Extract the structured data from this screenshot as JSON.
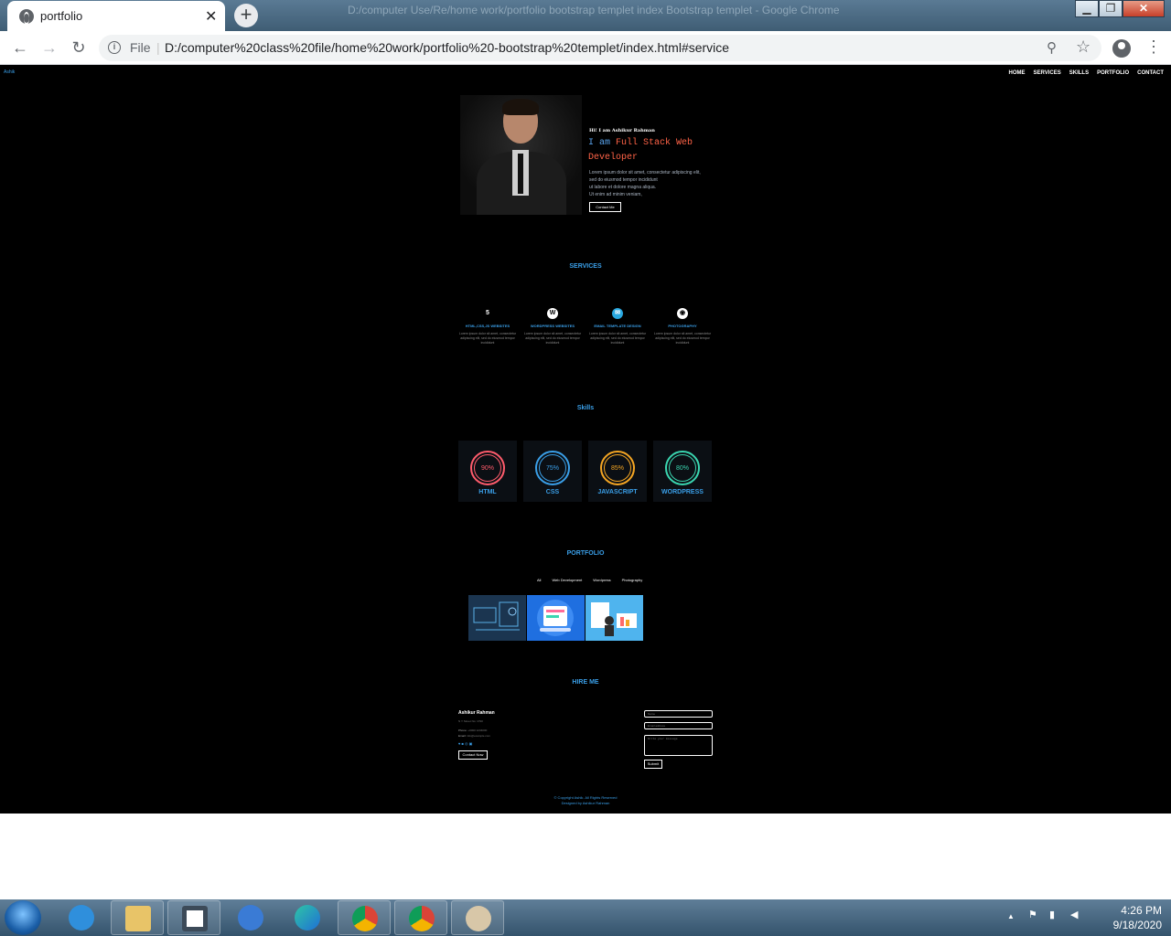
{
  "browser": {
    "tab_title": "portfolio",
    "tab_close": "✕",
    "new_tab": "+",
    "blurred_title": "D:/computer Use/Re/home work/portfolio bootstrap templet index Bootstrap templet - Google Chrome",
    "address": {
      "scheme_label": "File",
      "url": "D:/computer%20class%20file/home%20work/portfolio%20-bootstrap%20templet/index.html#service"
    },
    "icons": {
      "back": "back-arrow-icon",
      "forward": "forward-arrow-icon",
      "reload": "reload-icon",
      "zoom": "zoom-icon",
      "bookmark": "star-icon",
      "profile": "profile-icon",
      "menu": "kebab-menu-icon"
    }
  },
  "site": {
    "brand": "Ashik",
    "nav": [
      "HOME",
      "SERVICES",
      "SKILLS",
      "PORTFOLIO",
      "CONTACT"
    ],
    "hero": {
      "greeting": "Hi! I am Ashikur Rahman",
      "role_prefix": "I am",
      "role_line1": "Full Stack Web",
      "role_line2": "Developer",
      "intro": [
        "Lorem ipsum dolor sit amet, consectetur adipiscing elit,",
        "sed do eiusmod tempor incididunt",
        "ut labore et dolore magna aliqua.",
        "Ut enim ad minim veniam,"
      ],
      "cta": "Contact Me"
    },
    "services": {
      "title": "SERVICES",
      "items": [
        {
          "icon": "5",
          "title": "HTML,CSS,JS WEBSITES",
          "desc": "Lorem ipsum dolor sit amet, consectetur adipiscing elit, sed do eiusmod tempor incididunt"
        },
        {
          "icon": "W",
          "title": "WORDPRESS WEBSITES",
          "desc": "Lorem ipsum dolor sit amet, consectetur adipiscing elit, sed do eiusmod tempor incididunt"
        },
        {
          "icon": "✉",
          "title": "EMAIL TEMPLATE DESIGN",
          "desc": "Lorem ipsum dolor sit amet, consectetur adipiscing elit, sed do eiusmod tempor incididunt"
        },
        {
          "icon": "◉",
          "title": "PHOTOGRAPHY",
          "desc": "Lorem ipsum dolor sit amet, consectetur adipiscing elit, sed do eiusmod tempor incididunt"
        }
      ]
    },
    "skills": {
      "title": "Skills",
      "items": [
        {
          "name": "HTML",
          "percent": "90%",
          "color": "#ff5c6c"
        },
        {
          "name": "CSS",
          "percent": "75%",
          "color": "#3a9fe8"
        },
        {
          "name": "JAVASCRIPT",
          "percent": "85%",
          "color": "#f5a623"
        },
        {
          "name": "WORDPRESS",
          "percent": "80%",
          "color": "#3ad6b0"
        }
      ]
    },
    "portfolio": {
      "title": "PORTFOLIO",
      "filters": [
        "All",
        "Web Development",
        "Wordpress",
        "Photography"
      ]
    },
    "hire": {
      "title": "HIRE ME",
      "name": "Ashikur Rahman",
      "address": "N Y Street No: 1790",
      "phone_label": "Phone:",
      "phone": "+0000 1234000",
      "email_label": "Email:",
      "email": "info@example.com",
      "social": "♥ ■ ◎ ▣",
      "cta": "Contact Now",
      "form": {
        "name_placeholder": "Name",
        "email_placeholder": "Email address",
        "message_placeholder": "Write your message",
        "submit": "Submit"
      }
    },
    "footer": {
      "line1": "© Copyright Ashik. All Rights Reserved",
      "line2": "Designed by Ashikur Rahman"
    }
  },
  "taskbar": {
    "apps": [
      "internet-explorer-icon",
      "file-explorer-icon",
      "app-icon",
      "webcam-icon",
      "edge-icon",
      "chrome-icon",
      "chrome-icon",
      "paint-icon"
    ],
    "tray_arrow": "▲",
    "time": "4:26 PM",
    "date": "9/18/2020"
  },
  "colors": {
    "accent": "#3a9fe8",
    "hero_role": "#ff6347",
    "page_bg": "#000000"
  }
}
